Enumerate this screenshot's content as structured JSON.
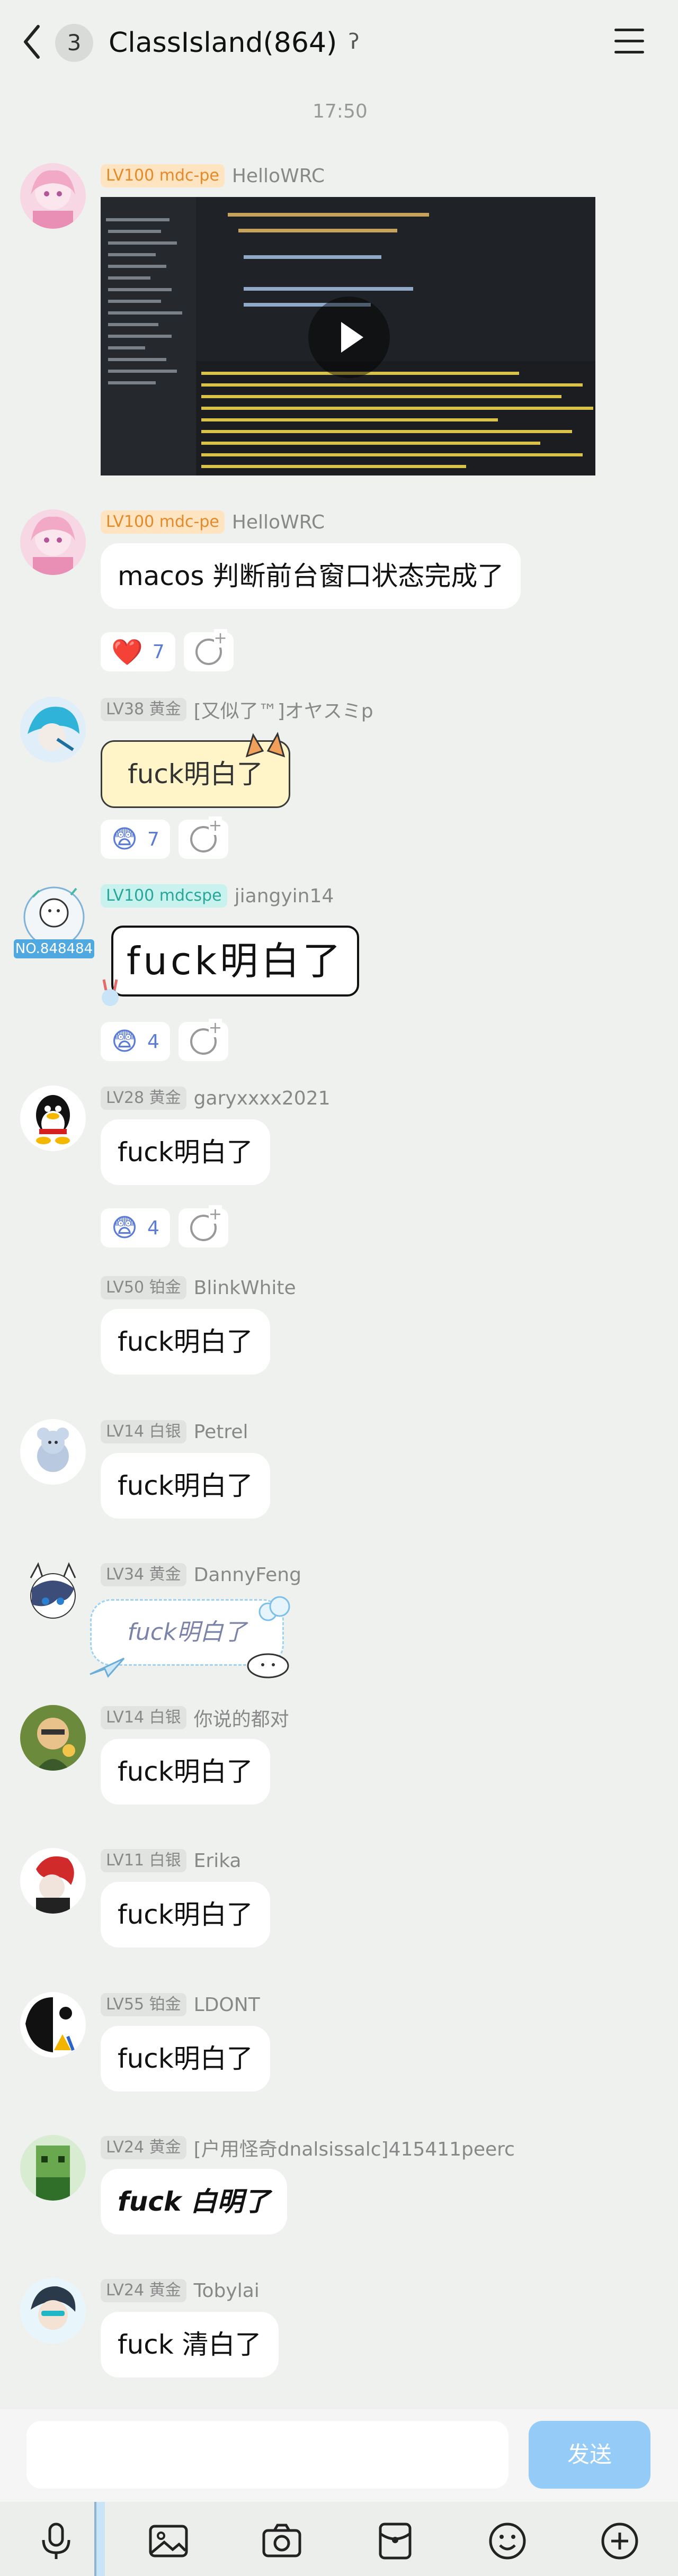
{
  "header": {
    "back_label": "back",
    "unread_count": "3",
    "title": "ClassIsland(864)",
    "ear_icon": "ear-icon",
    "menu_icon": "menu-icon"
  },
  "timestamp": "17:50",
  "messages": [
    {
      "level": "LV100 mdc-pe",
      "nick": "HelloWRC",
      "type": "video"
    },
    {
      "level": "LV100 mdc-pe",
      "nick": "HelloWRC",
      "text": "macos 判断前台窗口状态完成了",
      "reaction_count": "7",
      "reaction_emoji": "❤️"
    },
    {
      "level": "LV38 黄金",
      "nick": "[又似了™]オヤスミp",
      "text": "fuck明白了",
      "reaction_count": "7",
      "reaction_emoji": "😨"
    },
    {
      "level": "LV100 mdcspe",
      "nick": "jiangyin14",
      "text": "fuck明白了",
      "reaction_count": "4",
      "reaction_emoji": "😨",
      "avatar_tag": "NO.848484"
    },
    {
      "level": "LV28 黄金",
      "nick": "garyxxxx2021",
      "text": "fuck明白了",
      "reaction_count": "4",
      "reaction_emoji": "😨"
    },
    {
      "level": "LV50 铂金",
      "nick": "BlinkWhite",
      "text": "fuck明白了"
    },
    {
      "level": "LV14 白银",
      "nick": "Petrel",
      "text": "fuck明白了"
    },
    {
      "level": "LV34 黄金",
      "nick": "DannyFeng",
      "text": "fuck明白了"
    },
    {
      "level": "LV14 白银",
      "nick": "你说的都对",
      "text": "fuck明白了"
    },
    {
      "level": "LV11 白银",
      "nick": "Erika",
      "text": "fuck明白了"
    },
    {
      "level": "LV55 铂金",
      "nick": "LDONT",
      "text": "fuck明白了"
    },
    {
      "level": "LV24 黄金",
      "nick": "[户用怪奇dnalsissalc]415411peerc",
      "text": "fuck 白明了"
    },
    {
      "level": "LV24 黄金",
      "nick": "Tobylai",
      "text": "fuck 清白了"
    }
  ],
  "input": {
    "placeholder": "",
    "send_label": "发送"
  },
  "toolbar": [
    "mic-icon",
    "image-icon",
    "camera-icon",
    "red-packet-icon",
    "emoji-icon",
    "plus-icon"
  ],
  "colors": {
    "background": "#eef1ee",
    "send_button": "#95cbf7",
    "level_gold_bg": "#ffe4c2",
    "level_gold_text": "#e38a2a"
  }
}
